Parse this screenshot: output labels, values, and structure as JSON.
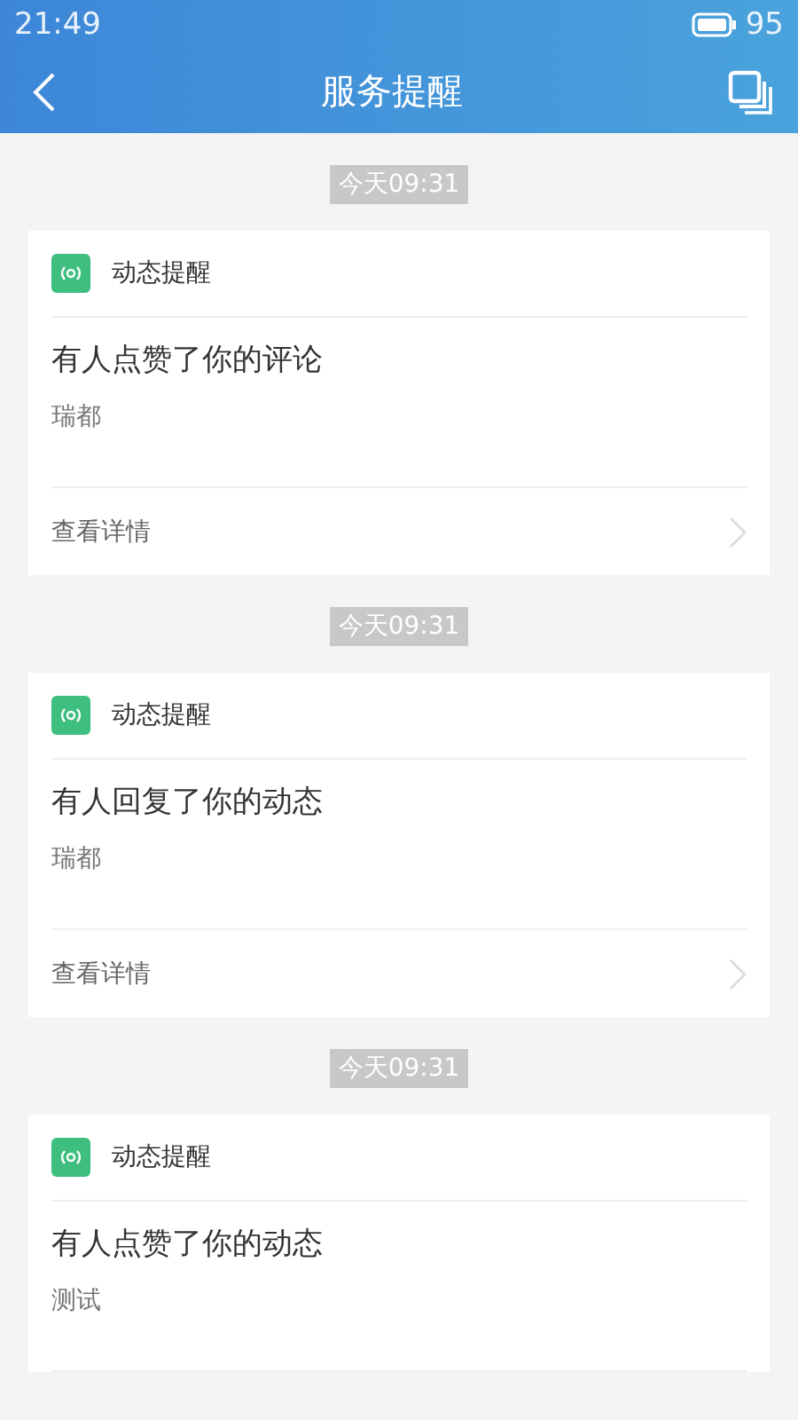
{
  "status_bar": {
    "time": "21:49",
    "battery": "95"
  },
  "header": {
    "title": "服务提醒"
  },
  "messages": [
    {
      "timestamp": "今天09:31",
      "source": "动态提醒",
      "title": "有人点赞了你的评论",
      "subtitle": "瑞都",
      "link": "查看详情"
    },
    {
      "timestamp": "今天09:31",
      "source": "动态提醒",
      "title": "有人回复了你的动态",
      "subtitle": "瑞都",
      "link": "查看详情"
    },
    {
      "timestamp": "今天09:31",
      "source": "动态提醒",
      "title": "有人点赞了你的动态",
      "subtitle": "测试"
    }
  ]
}
